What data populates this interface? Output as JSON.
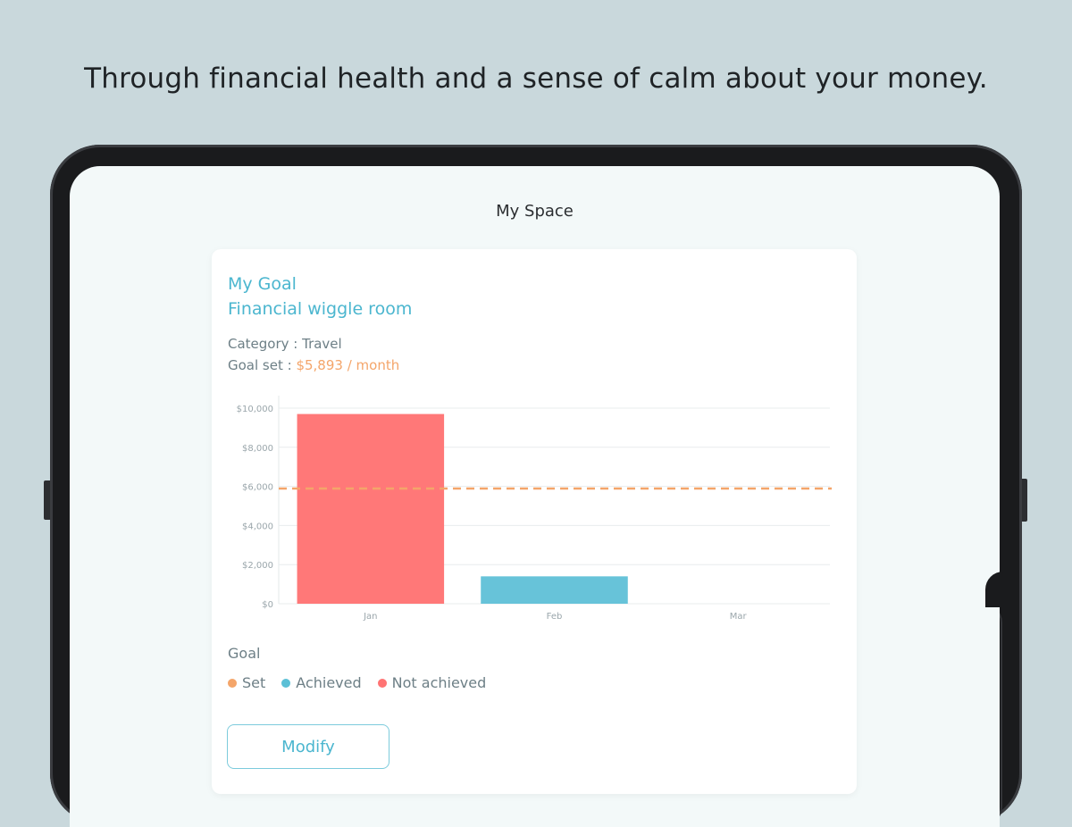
{
  "tagline": "Through financial health and a sense of calm about your money.",
  "screen": {
    "title": "My Space"
  },
  "goal": {
    "label": "My Goal",
    "name": "Financial wiggle room",
    "category_text": "Category : Travel",
    "goal_set_prefix": "Goal set : ",
    "goal_set_amount": "$5,893 / month"
  },
  "legend": {
    "title": "Goal",
    "items": [
      {
        "label": "Set",
        "color": "#f4a56a"
      },
      {
        "label": "Achieved",
        "color": "#5cc0d6"
      },
      {
        "label": "Not achieved",
        "color": "#ff7474"
      }
    ]
  },
  "modify_label": "Modify",
  "chart_data": {
    "type": "bar",
    "categories": [
      "Jan",
      "Feb",
      "Mar"
    ],
    "values": [
      9700,
      1400,
      0
    ],
    "bar_colors": [
      "#ff7878",
      "#67c3d9",
      "#67c3d9"
    ],
    "goal_line": {
      "value": 5893,
      "color": "#f4a56a"
    },
    "ylim": [
      0,
      10000
    ],
    "yticks": [
      0,
      2000,
      4000,
      6000,
      8000,
      10000
    ],
    "ytick_labels": [
      "$0",
      "$2,000",
      "$4,000",
      "$6,000",
      "$8,000",
      "$10,000"
    ],
    "grid": true,
    "legend": "bottom-left"
  }
}
